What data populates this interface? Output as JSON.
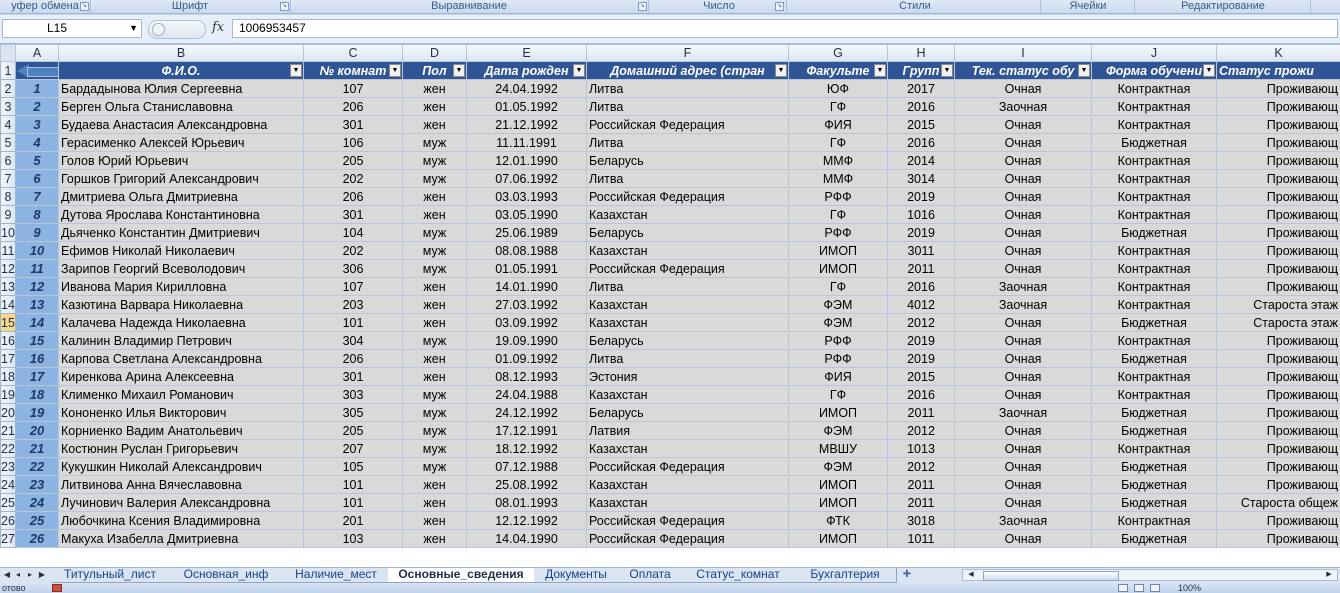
{
  "ribbon": {
    "groups": [
      "уфер обмена",
      "Шрифт",
      "Выравнивание",
      "Число",
      "Стили",
      "Ячейки",
      "Редактирование"
    ]
  },
  "formula_bar": {
    "name_box": "L15",
    "fx_label": "fx",
    "value": "1006953457"
  },
  "columns": [
    "A",
    "B",
    "C",
    "D",
    "E",
    "F",
    "G",
    "H",
    "I",
    "J",
    "K"
  ],
  "table_header": [
    "",
    "Ф.И.О.",
    "№ комнат",
    "Пол",
    "Дата рожден",
    "Домашний адрес (стран",
    "Факульте",
    "Групп",
    "Тек. статус обу",
    "Форма обучени",
    "Статус прожи"
  ],
  "rows": [
    {
      "row": "2",
      "n": "1",
      "fio": "Бардадынова Юлия Сергеевна",
      "room": "107",
      "sex": "жен",
      "dob": "24.04.1992",
      "addr": "Литва",
      "fac": "ЮФ",
      "grp": "2017",
      "status": "Очная",
      "form": "Контрактная",
      "live": "Проживающ"
    },
    {
      "row": "3",
      "n": "2",
      "fio": "Берген Ольга Станиславовна",
      "room": "206",
      "sex": "жен",
      "dob": "01.05.1992",
      "addr": "Литва",
      "fac": "ГФ",
      "grp": "2016",
      "status": "Заочная",
      "form": "Контрактная",
      "live": "Проживающ"
    },
    {
      "row": "4",
      "n": "3",
      "fio": "Будаева Анастасия Александровна",
      "room": "301",
      "sex": "жен",
      "dob": "21.12.1992",
      "addr": "Российская Федерация",
      "fac": "ФИЯ",
      "grp": "2015",
      "status": "Очная",
      "form": "Контрактная",
      "live": "Проживающ"
    },
    {
      "row": "5",
      "n": "4",
      "fio": "Герасименко Алексей Юрьевич",
      "room": "106",
      "sex": "муж",
      "dob": "11.11.1991",
      "addr": "Литва",
      "fac": "ГФ",
      "grp": "2016",
      "status": "Очная",
      "form": "Бюджетная",
      "live": "Проживающ"
    },
    {
      "row": "6",
      "n": "5",
      "fio": "Голов Юрий Юрьевич",
      "room": "205",
      "sex": "муж",
      "dob": "12.01.1990",
      "addr": "Беларусь",
      "fac": "ММФ",
      "grp": "2014",
      "status": "Очная",
      "form": "Контрактная",
      "live": "Проживающ"
    },
    {
      "row": "7",
      "n": "6",
      "fio": "Горшков Григорий Александрович",
      "room": "202",
      "sex": "муж",
      "dob": "07.06.1992",
      "addr": "Литва",
      "fac": "ММФ",
      "grp": "3014",
      "status": "Очная",
      "form": "Контрактная",
      "live": "Проживающ"
    },
    {
      "row": "8",
      "n": "7",
      "fio": "Дмитриева Ольга Дмитриевна",
      "room": "206",
      "sex": "жен",
      "dob": "03.03.1993",
      "addr": "Российская Федерация",
      "fac": "РФФ",
      "grp": "2019",
      "status": "Очная",
      "form": "Контрактная",
      "live": "Проживающ"
    },
    {
      "row": "9",
      "n": "8",
      "fio": "Дутова Ярослава Константиновна",
      "room": "301",
      "sex": "жен",
      "dob": "03.05.1990",
      "addr": "Казахстан",
      "fac": "ГФ",
      "grp": "1016",
      "status": "Очная",
      "form": "Контрактная",
      "live": "Проживающ"
    },
    {
      "row": "10",
      "n": "9",
      "fio": "Дьяченко Константин Дмитриевич",
      "room": "104",
      "sex": "муж",
      "dob": "25.06.1989",
      "addr": "Беларусь",
      "fac": "РФФ",
      "grp": "2019",
      "status": "Очная",
      "form": "Бюджетная",
      "live": "Проживающ"
    },
    {
      "row": "11",
      "n": "10",
      "fio": "Ефимов Николай Николаевич",
      "room": "202",
      "sex": "муж",
      "dob": "08.08.1988",
      "addr": "Казахстан",
      "fac": "ИМОП",
      "grp": "3011",
      "status": "Очная",
      "form": "Контрактная",
      "live": "Проживающ"
    },
    {
      "row": "12",
      "n": "11",
      "fio": "Зарипов Георгий Всеволодович",
      "room": "306",
      "sex": "муж",
      "dob": "01.05.1991",
      "addr": "Российская Федерация",
      "fac": "ИМОП",
      "grp": "2011",
      "status": "Очная",
      "form": "Контрактная",
      "live": "Проживающ"
    },
    {
      "row": "13",
      "n": "12",
      "fio": "Иванова Мария Кирилловна",
      "room": "107",
      "sex": "жен",
      "dob": "14.01.1990",
      "addr": "Литва",
      "fac": "ГФ",
      "grp": "2016",
      "status": "Заочная",
      "form": "Контрактная",
      "live": "Проживающ"
    },
    {
      "row": "14",
      "n": "13",
      "fio": "Казютина Варвара Николаевна",
      "room": "203",
      "sex": "жен",
      "dob": "27.03.1992",
      "addr": "Казахстан",
      "fac": "ФЭМ",
      "grp": "4012",
      "status": "Заочная",
      "form": "Контрактная",
      "live": "Староста этаж"
    },
    {
      "row": "15",
      "n": "14",
      "fio": "Калачева Надежда Николаевна",
      "room": "101",
      "sex": "жен",
      "dob": "03.09.1992",
      "addr": "Казахстан",
      "fac": "ФЭМ",
      "grp": "2012",
      "status": "Очная",
      "form": "Бюджетная",
      "live": "Староста этаж"
    },
    {
      "row": "16",
      "n": "15",
      "fio": "Калинин Владимир Петрович",
      "room": "304",
      "sex": "муж",
      "dob": "19.09.1990",
      "addr": "Беларусь",
      "fac": "РФФ",
      "grp": "2019",
      "status": "Очная",
      "form": "Контрактная",
      "live": "Проживающ"
    },
    {
      "row": "17",
      "n": "16",
      "fio": "Карпова Светлана Александровна",
      "room": "206",
      "sex": "жен",
      "dob": "01.09.1992",
      "addr": "Литва",
      "fac": "РФФ",
      "grp": "2019",
      "status": "Очная",
      "form": "Бюджетная",
      "live": "Проживающ"
    },
    {
      "row": "18",
      "n": "17",
      "fio": "Киренкова Арина Алексеевна",
      "room": "301",
      "sex": "жен",
      "dob": "08.12.1993",
      "addr": "Эстония",
      "fac": "ФИЯ",
      "grp": "2015",
      "status": "Очная",
      "form": "Контрактная",
      "live": "Проживающ"
    },
    {
      "row": "19",
      "n": "18",
      "fio": "Клименко Михаил Романович",
      "room": "303",
      "sex": "муж",
      "dob": "24.04.1988",
      "addr": "Казахстан",
      "fac": "ГФ",
      "grp": "2016",
      "status": "Очная",
      "form": "Контрактная",
      "live": "Проживающ"
    },
    {
      "row": "20",
      "n": "19",
      "fio": "Кононенко Илья Викторович",
      "room": "305",
      "sex": "муж",
      "dob": "24.12.1992",
      "addr": "Беларусь",
      "fac": "ИМОП",
      "grp": "2011",
      "status": "Заочная",
      "form": "Бюджетная",
      "live": "Проживающ"
    },
    {
      "row": "21",
      "n": "20",
      "fio": "Корниенко Вадим Анатольевич",
      "room": "205",
      "sex": "муж",
      "dob": "17.12.1991",
      "addr": "Латвия",
      "fac": "ФЭМ",
      "grp": "2012",
      "status": "Очная",
      "form": "Бюджетная",
      "live": "Проживающ"
    },
    {
      "row": "22",
      "n": "21",
      "fio": "Костюнин Руслан Григорьевич",
      "room": "207",
      "sex": "муж",
      "dob": "18.12.1992",
      "addr": "Казахстан",
      "fac": "МВШУ",
      "grp": "1013",
      "status": "Очная",
      "form": "Контрактная",
      "live": "Проживающ"
    },
    {
      "row": "23",
      "n": "22",
      "fio": "Кукушкин Николай Александрович",
      "room": "105",
      "sex": "муж",
      "dob": "07.12.1988",
      "addr": "Российская Федерация",
      "fac": "ФЭМ",
      "grp": "2012",
      "status": "Очная",
      "form": "Бюджетная",
      "live": "Проживающ"
    },
    {
      "row": "24",
      "n": "23",
      "fio": "Литвинова Анна Вячеславовна",
      "room": "101",
      "sex": "жен",
      "dob": "25.08.1992",
      "addr": "Казахстан",
      "fac": "ИМОП",
      "grp": "2011",
      "status": "Очная",
      "form": "Бюджетная",
      "live": "Проживающ"
    },
    {
      "row": "25",
      "n": "24",
      "fio": "Лучинович Валерия Александровна",
      "room": "101",
      "sex": "жен",
      "dob": "08.01.1993",
      "addr": "Казахстан",
      "fac": "ИМОП",
      "grp": "2011",
      "status": "Очная",
      "form": "Бюджетная",
      "live": "Староста общеж"
    },
    {
      "row": "26",
      "n": "25",
      "fio": "Любочкина Ксения Владимировна",
      "room": "201",
      "sex": "жен",
      "dob": "12.12.1992",
      "addr": "Российская Федерация",
      "fac": "ФТК",
      "grp": "3018",
      "status": "Заочная",
      "form": "Контрактная",
      "live": "Проживающ"
    },
    {
      "row": "27",
      "n": "26",
      "fio": "Макуха Изабелла Дмитриевна",
      "room": "103",
      "sex": "жен",
      "dob": "14.04.1990",
      "addr": "Российская Федерация",
      "fac": "ИМОП",
      "grp": "1011",
      "status": "Очная",
      "form": "Бюджетная",
      "live": "Проживающ"
    }
  ],
  "header_row_num": "1",
  "active_row": "15",
  "sheet_tabs": [
    "Титульный_лист",
    "Основная_инф",
    "Наличие_мест",
    "Основные_сведения",
    "Документы",
    "Оплата",
    "Статус_комнат",
    "Бухгалтерия"
  ],
  "active_tab": "Основные_сведения",
  "status_bar": {
    "ready": "отово",
    "zoom": "100%"
  }
}
